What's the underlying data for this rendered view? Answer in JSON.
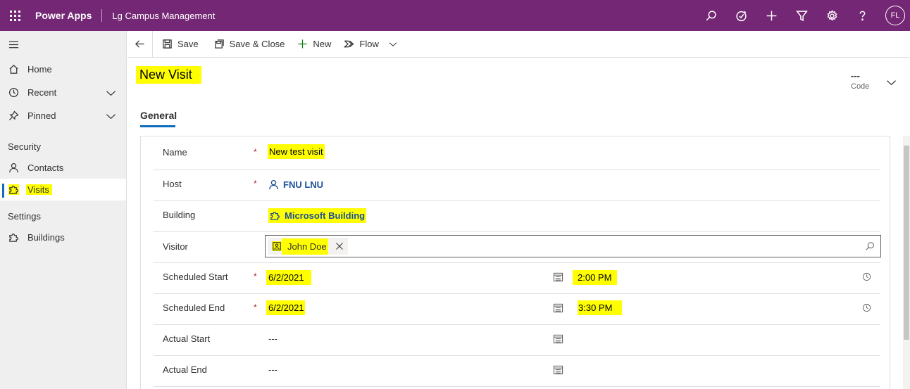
{
  "topbar": {
    "app_name": "Power Apps",
    "environment": "Lg Campus Management",
    "avatar_initials": "FL",
    "icons": [
      "search-icon",
      "assistant-icon",
      "plus-icon",
      "filter-icon",
      "settings-icon",
      "help-icon"
    ],
    "bg_color": "#742774"
  },
  "sidebar": {
    "items": [
      {
        "label": "Home",
        "icon": "home-icon"
      },
      {
        "label": "Recent",
        "icon": "clock-icon"
      },
      {
        "label": "Pinned",
        "icon": "pin-icon"
      }
    ],
    "security_header": "Security",
    "security_items": [
      {
        "label": "Contacts",
        "icon": "person-icon"
      },
      {
        "label": "Visits",
        "icon": "puzzle-icon",
        "active": true
      }
    ],
    "settings_header": "Settings",
    "settings_items": [
      {
        "label": "Buildings",
        "icon": "puzzle-icon"
      }
    ]
  },
  "cmdbar": {
    "save": "Save",
    "save_close": "Save & Close",
    "new": "New",
    "flow": "Flow"
  },
  "header": {
    "title": "New Visit",
    "code_value": "---",
    "code_label": "Code"
  },
  "tabs": {
    "general": "General"
  },
  "form": {
    "name": {
      "label": "Name",
      "value": "New test visit",
      "required": "*"
    },
    "host": {
      "label": "Host",
      "value": "FNU LNU",
      "required": "*"
    },
    "building": {
      "label": "Building",
      "value": "Microsoft Building"
    },
    "visitor": {
      "label": "Visitor",
      "value": "John Doe"
    },
    "scheduled_start": {
      "label": "Scheduled Start",
      "date": "6/2/2021",
      "time": "2:00 PM",
      "required": "*"
    },
    "scheduled_end": {
      "label": "Scheduled End",
      "date": "6/2/2021",
      "time": "3:30 PM",
      "required": "*"
    },
    "actual_start": {
      "label": "Actual Start",
      "date": "---"
    },
    "actual_end": {
      "label": "Actual End",
      "date": "---"
    }
  },
  "colors": {
    "highlight": "#ffff00",
    "accent": "#0f6cbd",
    "required": "#a4262c",
    "link": "#1b4f9a"
  }
}
